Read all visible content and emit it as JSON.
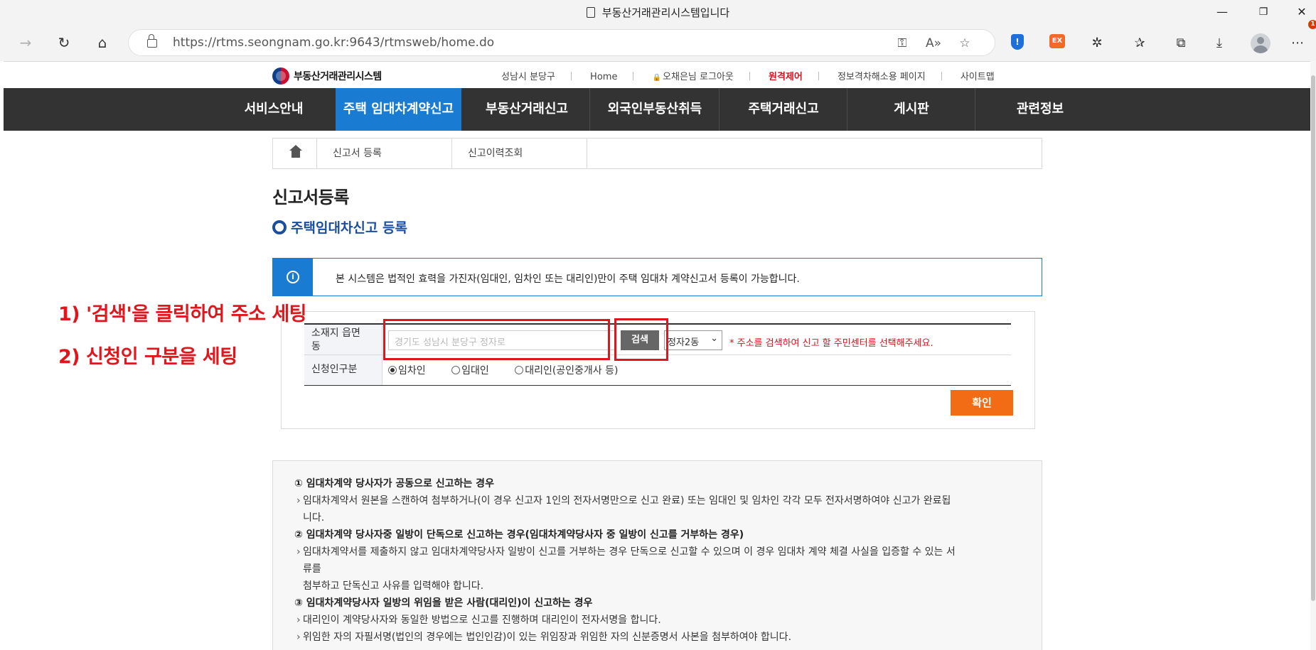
{
  "browser": {
    "tab_title": "부동산거래관리시스템입니다",
    "url_host": "https://rtms.seongnam.go.kr",
    "url_path": ":9643/rtmsweb/home.do",
    "window_min": "—",
    "window_restore": "❐",
    "window_close": "✕",
    "ext_shield_label": "!",
    "ext_ex_label": "EX",
    "notif_count": "1"
  },
  "site": {
    "logo_text": "부동산거래관리시스템",
    "util_links": {
      "district": "성남시 분당구",
      "home": "Home",
      "logout": "오채은님 로그아웃",
      "remote": "원격제어",
      "accessibility": "정보격차해소용 페이지",
      "sitemap": "사이트맵"
    },
    "gnb": [
      "서비스안내",
      "주택 임대차계약신고",
      "부동산거래신고",
      "외국인부동산취득",
      "주택거래신고",
      "게시판",
      "관련정보"
    ],
    "gnb_active_index": 1,
    "sub_tabs": [
      "신고서 등록",
      "신고이력조회"
    ],
    "page_title": "신고서등록",
    "section_title": "주택임대차신고 등록",
    "notice": "본 시스템은 법적인 효력을 가진자(임대인, 임차인 또는 대리인)만이 주택 임대차 계약신고서 등록이 가능합니다.",
    "form": {
      "address_label_1": "소재지 읍면",
      "address_label_2": "동",
      "address_value": "경기도 성남시 분당구 정자로",
      "search_button": "검색",
      "dong_select": "정자2동",
      "address_hint": "* 주소를 검색하여 신고 할 주민센터를 선택해주세요.",
      "applicant_label": "신청인구분",
      "applicant_options": [
        "임차인",
        "임대인",
        "대리인(공인중개사 등)"
      ],
      "applicant_selected": 0,
      "confirm_button": "확인"
    },
    "guide": {
      "h1": "① 임대차계약 당사자가 공동으로 신고하는 경우",
      "l1a": "임대차계약서 원본을 스캔하여 첨부하거나(이 경우 신고자 1인의 전자서명만으로 신고 완료) 또는 임대인 및 임차인 각각 모두 전자서명하여야 신고가 완료됩",
      "l1b": "니다.",
      "h2": "② 임대차계약 당사자중 일방이 단독으로 신고하는 경우(임대차계약당사자 중 일방이 신고를 거부하는 경우)",
      "l2a": "임대차계약서를 제출하지 않고 임대차계약당사자 일방이 신고를 거부하는 경우 단독으로 신고할 수 있으며 이 경우 임대차 계약 체결 사실을 입증할 수 있는 서",
      "l2b": "류를",
      "l2c": "첨부하고 단독신고 사유를 입력해야 합니다.",
      "h3": "③ 임대차계약당사자 일방의 위임을 받은 사람(대리인)이 신고하는 경우",
      "l3a": "대리인이 계약당사자와 동일한 방법으로 신고를 진행하며 대리인이 전자서명을 합니다.",
      "l3b": "위임한 자의 자필서명(법인의 경우에는 법인인감)이 있는 위임장과 위임한 자의 신분증명서 사본을 첨부하여야 합니다."
    }
  },
  "annotations": {
    "step1": "1) '검색'을 클릭하여 주소 세팅",
    "step2": "2) 신청인 구분을 세팅"
  },
  "colors": {
    "gnb_bg": "#333333",
    "gnb_active": "#1a7bd3",
    "accent_blue": "#1c4ea0",
    "confirm_orange": "#f26b15",
    "annotation_red": "#e0161c"
  }
}
